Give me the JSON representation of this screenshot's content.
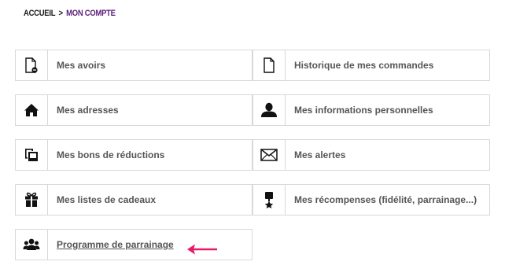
{
  "breadcrumb": {
    "home": "ACCUEIL",
    "separator": ">",
    "current": "MON COMPTE"
  },
  "tiles": [
    {
      "label": "Mes avoirs",
      "icon": "document-minus-icon"
    },
    {
      "label": "Historique de mes commandes",
      "icon": "document-icon"
    },
    {
      "label": "Mes adresses",
      "icon": "home-icon"
    },
    {
      "label": "Mes informations personnelles",
      "icon": "user-icon"
    },
    {
      "label": "Mes bons de réductions",
      "icon": "copy-icon"
    },
    {
      "label": "Mes alertes",
      "icon": "envelope-icon"
    },
    {
      "label": "Mes listes de cadeaux",
      "icon": "gift-icon"
    },
    {
      "label": "Mes récompenses (fidélité, parrainage...)",
      "icon": "award-icon"
    },
    {
      "label": "Programme de parrainage",
      "icon": "users-group-icon"
    }
  ],
  "colors": {
    "breadcrumb_current": "#5a1e7a",
    "highlight_arrow": "#e6196b",
    "label_text": "#555555",
    "tile_border": "#d8d8d8"
  }
}
